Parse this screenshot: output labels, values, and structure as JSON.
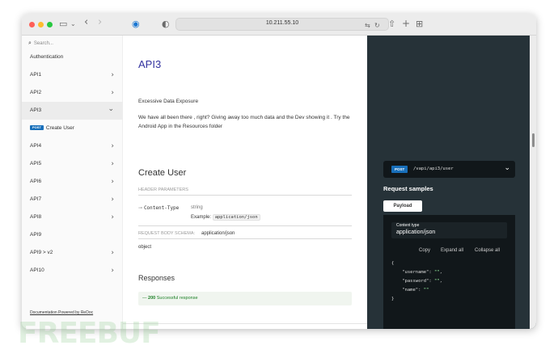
{
  "browser": {
    "url": "10.211.55.10",
    "lights": [
      "#fe5f57",
      "#febc2e",
      "#28c840"
    ]
  },
  "sidebar": {
    "search_placeholder": "Search...",
    "items": [
      {
        "label": "Authentication",
        "chevron": ""
      },
      {
        "label": "API1",
        "chevron": "›"
      },
      {
        "label": "API2",
        "chevron": "›"
      },
      {
        "label": "API3",
        "chevron": "⌄",
        "active": true
      },
      {
        "label": "Create User",
        "badge": "POST"
      },
      {
        "label": "API4",
        "chevron": "›"
      },
      {
        "label": "API5",
        "chevron": "›"
      },
      {
        "label": "API6",
        "chevron": "›"
      },
      {
        "label": "API7",
        "chevron": "›"
      },
      {
        "label": "API8",
        "chevron": "›"
      },
      {
        "label": "API9",
        "chevron": ""
      },
      {
        "label": "API9 > v2",
        "chevron": "›"
      },
      {
        "label": "API10",
        "chevron": "›"
      }
    ],
    "powered": "Documentation Powered by ReDoc"
  },
  "content": {
    "api_title": "API3",
    "subtitle": "Excessive Data Exposure",
    "description": "We have all been there , right? Giving away too much data and the Dev showing it . Try the Android App in the Resources folder",
    "operation_title": "Create User",
    "header_params_label": "HEADER PARAMETERS",
    "param_name": "Content-Type",
    "param_type": "string",
    "example_label": "Example:",
    "example_value": "application/json",
    "body_schema_label": "REQUEST BODY SCHEMA:",
    "body_schema_value": "application/json",
    "body_type": "object",
    "responses_title": "Responses",
    "response_code": "200",
    "response_text": "Successful response"
  },
  "right_panel": {
    "method": "POST",
    "path": "/vapi/api3/user",
    "request_samples": "Request samples",
    "payload_tab": "Payload",
    "content_type_label": "Content type",
    "content_type_value": "application/json",
    "copy": "Copy",
    "expand_all": "Expand all",
    "collapse_all": "Collapse all",
    "code": {
      "open": "{",
      "username_key": "\"username\"",
      "username_val": "\"\"",
      "password_key": "\"password\"",
      "password_val": "\"\"",
      "name_key": "\"name\"",
      "name_val": "\"\"",
      "close": "}"
    }
  },
  "watermark": "FREEBUF"
}
